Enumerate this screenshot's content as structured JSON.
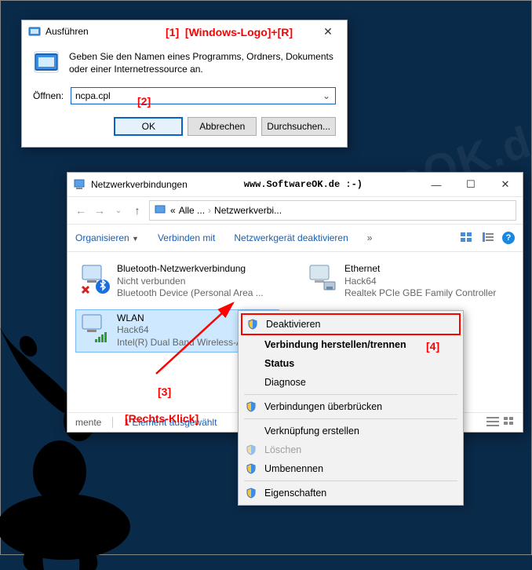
{
  "run": {
    "title": "Ausführen",
    "message": "Geben Sie den Namen eines Programms, Ordners, Dokuments oder einer Internetressource an.",
    "open_label": "Öffnen:",
    "open_value": "ncpa.cpl",
    "ok": "OK",
    "cancel": "Abbrechen",
    "browse": "Durchsuchen..."
  },
  "annots": {
    "a1": "[1]",
    "a1b": "[Windows-Logo]+[R]",
    "a2": "[2]",
    "a3": "[3]",
    "a3b": "[Rechts-Klick]",
    "a4": "[4]"
  },
  "explorer": {
    "title": "Netzwerkverbindungen",
    "watermark": "www.SoftwareOK.de :-)",
    "breadcrumb": {
      "p1": "Alle ...",
      "p2": "Netzwerkverbi..."
    },
    "toolbar": {
      "organize": "Organisieren",
      "connect": "Verbinden mit",
      "disable": "Netzwerkgerät deaktivieren"
    },
    "items": [
      {
        "l1": "Bluetooth-Netzwerkverbindung",
        "l2": "Nicht verbunden",
        "l3": "Bluetooth Device (Personal Area ..."
      },
      {
        "l1": "Ethernet",
        "l2": "Hack64",
        "l3": "Realtek PCIe GBE Family Controller"
      },
      {
        "l1": "WLAN",
        "l2": "Hack64",
        "l3": "Intel(R) Dual Band Wireless-AC 72..."
      }
    ],
    "status": {
      "seg1": "mente",
      "count": "1 Element ausgewählt"
    }
  },
  "ctx": {
    "disable": "Deaktivieren",
    "connect": "Verbindung herstellen/trennen",
    "status": "Status",
    "diagnose": "Diagnose",
    "bridge": "Verbindungen überbrücken",
    "shortcut": "Verknüpfung erstellen",
    "delete": "Löschen",
    "rename": "Umbenennen",
    "props": "Eigenschaften"
  },
  "watermark_big": "SoftwareOK.de"
}
